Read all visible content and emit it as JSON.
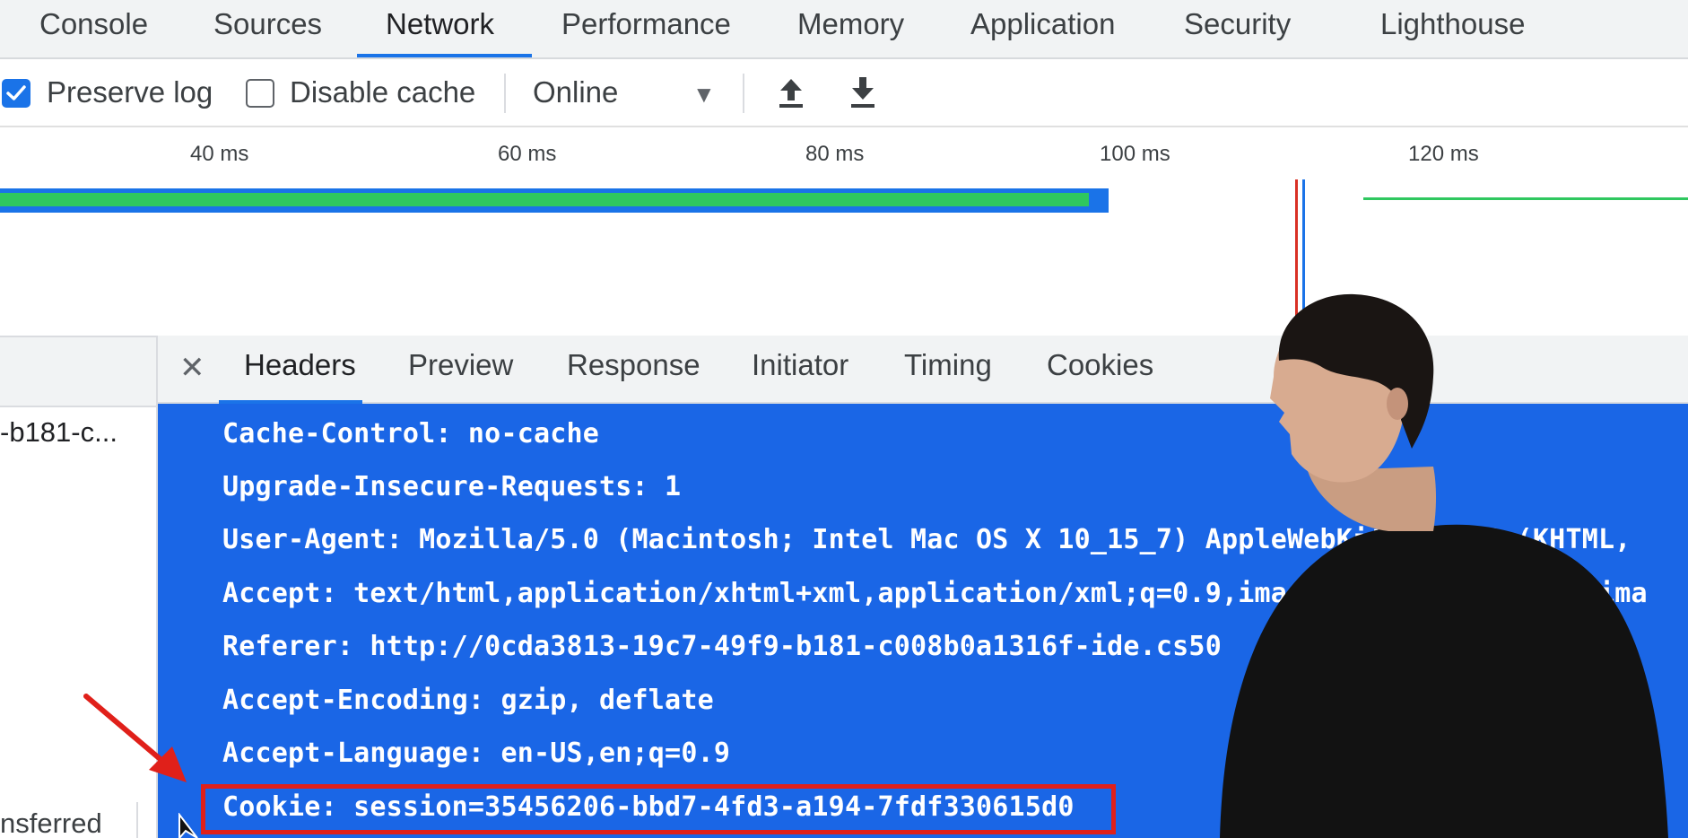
{
  "tabs": [
    {
      "label": "Console"
    },
    {
      "label": "Sources"
    },
    {
      "label": "Network",
      "active": true
    },
    {
      "label": "Performance"
    },
    {
      "label": "Memory"
    },
    {
      "label": "Application"
    },
    {
      "label": "Security"
    },
    {
      "label": "Lighthouse"
    }
  ],
  "toolbar": {
    "preserve_log": {
      "label": "Preserve log",
      "checked": true
    },
    "disable_cache": {
      "label": "Disable cache",
      "checked": false
    },
    "throttling": "Online",
    "icons": [
      "upload-icon",
      "download-icon"
    ]
  },
  "timeline": {
    "ticks": [
      "40 ms",
      "60 ms",
      "80 ms",
      "100 ms",
      "120 ms"
    ]
  },
  "request_list": {
    "name": "-b181-c...",
    "footer": "nsferred"
  },
  "details": {
    "subtabs": [
      {
        "label": "Headers",
        "active": true
      },
      {
        "label": "Preview"
      },
      {
        "label": "Response"
      },
      {
        "label": "Initiator"
      },
      {
        "label": "Timing"
      },
      {
        "label": "Cookies"
      }
    ],
    "headers": [
      "Cache-Control: no-cache",
      "Upgrade-Insecure-Requests: 1",
      "User-Agent: Mozilla/5.0 (Macintosh; Intel Mac OS X 10_15_7) AppleWebKit/537.36 (KHTML,",
      "Accept: text/html,application/xhtml+xml,application/xml;q=0.9,image/avif,image/webp,ima",
      "Referer: http://0cda3813-19c7-49f9-b181-c008b0a1316f-ide.cs50",
      "Accept-Encoding: gzip, deflate",
      "Accept-Language: en-US,en;q=0.9",
      "Cookie: session=35456206-bbd7-4fd3-a194-7fdf330615d0"
    ]
  },
  "colors": {
    "accent": "#1a73e8",
    "selection": "#1a66e6",
    "highlight": "#e0201a",
    "timeline_green": "#2fc75f"
  }
}
